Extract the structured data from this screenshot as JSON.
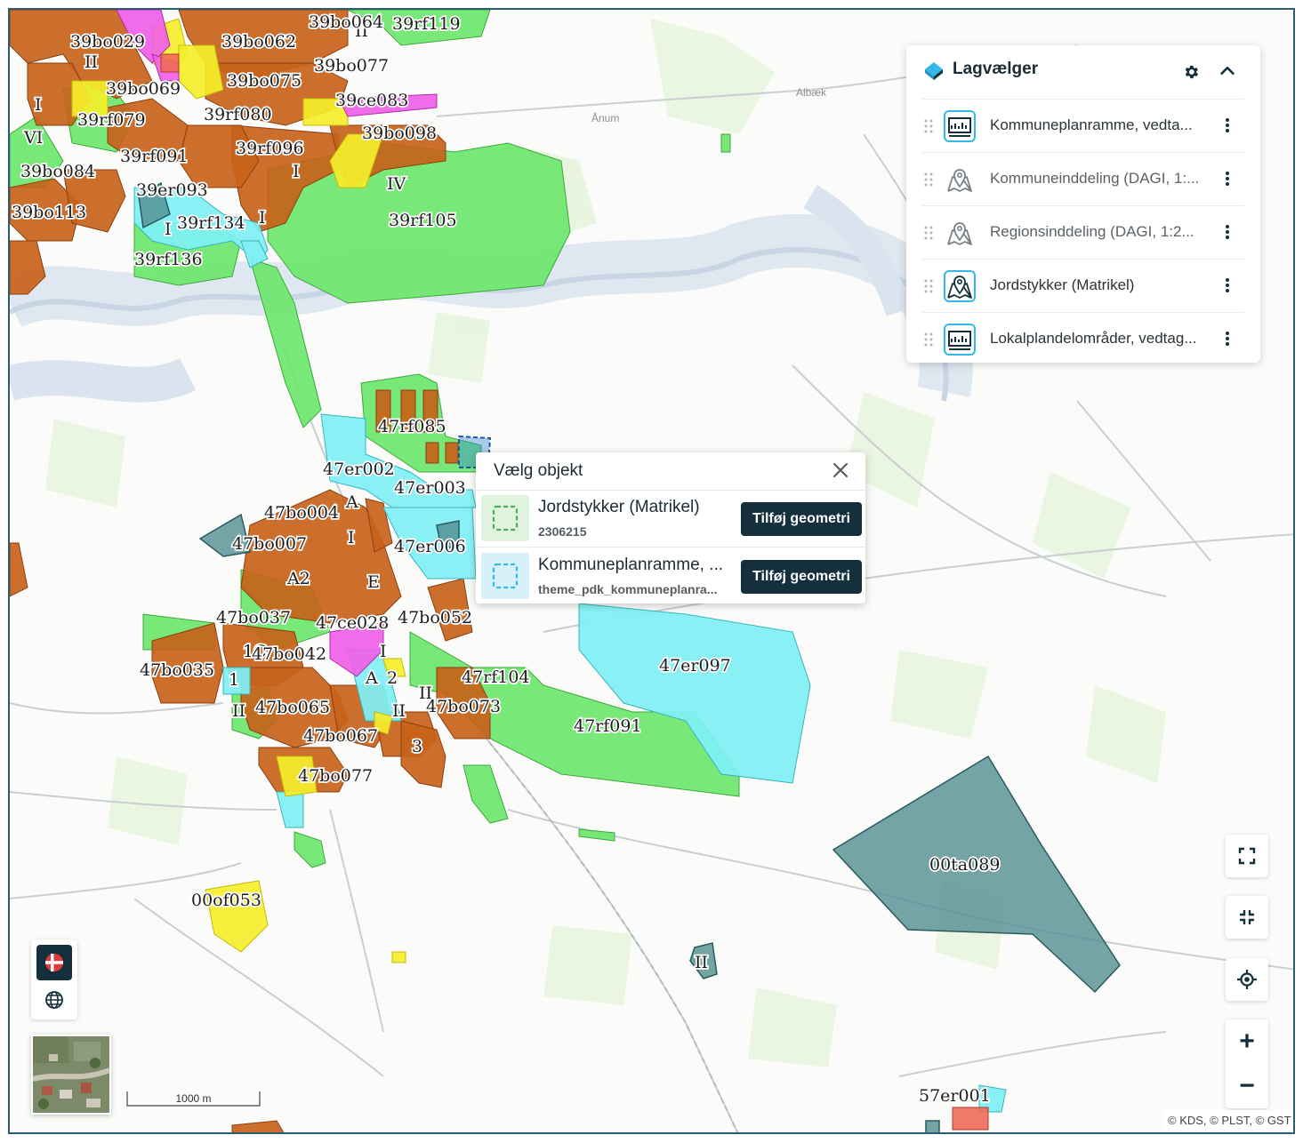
{
  "map": {
    "place_names": [
      "Albæk",
      "Ånum"
    ],
    "zone_labels": [
      "39bo064",
      "39rf119",
      "39bo029",
      "39bo062",
      "39bo077",
      "39bo069",
      "39bo075",
      "39ce083",
      "39rf079",
      "39rf080",
      "39bo098",
      "39rf091",
      "39rf096",
      "39bo084",
      "39er093",
      "39rf105",
      "39bo113",
      "39rf134",
      "39rf136",
      "47rf085",
      "47er002",
      "47er003",
      "47bo004",
      "47bo007",
      "47er006",
      "47bo037",
      "47ce028",
      "47bo052",
      "47bo035",
      "47bo042",
      "47rf104",
      "47er097",
      "47bo065",
      "47bo073",
      "47rf091",
      "47bo067",
      "47bo077",
      "00ta089",
      "00of053",
      "57er001"
    ],
    "roman_labels": [
      "II",
      "I",
      "VI",
      "I",
      "IV",
      "I",
      "II",
      "I",
      "A",
      "A2",
      "E",
      "I",
      "II",
      "1C",
      "1",
      "I",
      "2",
      "A",
      "II",
      "3",
      "II",
      "II"
    ],
    "colors": {
      "boligomrade": "#c8621a",
      "erhverv": "#7ff0f5",
      "rekreativt": "#6ce66c",
      "centerområde": "#f060e8",
      "offentlige": "#f5ee2a",
      "tekniske_anlaeg": "#4f8a8f"
    }
  },
  "layer_panel": {
    "title": "Lagvælger",
    "logo_icon": "layers-logo-icon",
    "settings_icon": "gear-icon",
    "collapse_icon": "chevron-up-icon",
    "layers": [
      {
        "name": "Kommuneplanramme, vedta...",
        "icon": "plan-layer-icon",
        "muted": false
      },
      {
        "name": "Kommuneinddeling (DAGI, 1:...",
        "icon": "map-pin-layer-icon",
        "muted": true
      },
      {
        "name": "Regionsinddeling (DAGI, 1:2...",
        "icon": "map-pin-layer-icon",
        "muted": true
      },
      {
        "name": "Jordstykker (Matrikel)",
        "icon": "map-pin-layer-icon",
        "muted": false
      },
      {
        "name": "Lokalplandelområder, vedtag...",
        "icon": "plan-layer-icon",
        "muted": false
      }
    ]
  },
  "popup": {
    "title": "Vælg objekt",
    "close_icon": "close-icon",
    "objects": [
      {
        "name": "Jordstykker (Matrikel)",
        "sub": "2306215",
        "button": "Tilføj geometri",
        "thumb_color": "#6fc96f"
      },
      {
        "name": "Kommuneplanramme, ...",
        "sub": "theme_pdk_kommuneplanra...",
        "button": "Tilføj geometri",
        "thumb_color": "#35b8e8"
      }
    ]
  },
  "controls": {
    "fullscreen_icon": "fullscreen-icon",
    "exit_fullscreen_icon": "exit-fullscreen-icon",
    "locate_icon": "locate-icon",
    "zoom_in": "+",
    "zoom_out": "−",
    "language_flag": "danish-flag-icon",
    "globe_icon": "globe-icon",
    "basemap": "aerial-basemap-thumbnail"
  },
  "scale": "1000 m",
  "attribution": "© KDS, © PLST, © GST"
}
